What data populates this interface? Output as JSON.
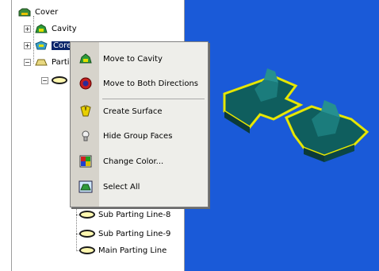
{
  "tree": {
    "root": "Cover",
    "items": [
      {
        "label": "Cavity"
      },
      {
        "label": "Core"
      },
      {
        "label": "Parting Lines"
      }
    ],
    "sub_items": [
      {
        "label": "Sub Parting Line-8"
      },
      {
        "label": "Sub Parting Line-9"
      },
      {
        "label": "Main Parting Line"
      }
    ]
  },
  "context_menu": {
    "items": [
      {
        "label": "Move to Cavity",
        "icon": "cavity-icon"
      },
      {
        "label": "Move to Both Directions",
        "icon": "both-directions-icon"
      },
      {
        "label": "Create Surface",
        "icon": "surface-icon"
      },
      {
        "label": "Hide Group Faces",
        "icon": "hide-faces-icon"
      },
      {
        "label": "Change Color...",
        "icon": "palette-icon"
      },
      {
        "label": "Select All",
        "icon": "select-all-icon"
      }
    ]
  },
  "colors": {
    "viewport_bg": "#1a5ad8",
    "part_fill": "#0f6a6a",
    "part_outline": "#e6e600",
    "selection": "#0a246a"
  }
}
